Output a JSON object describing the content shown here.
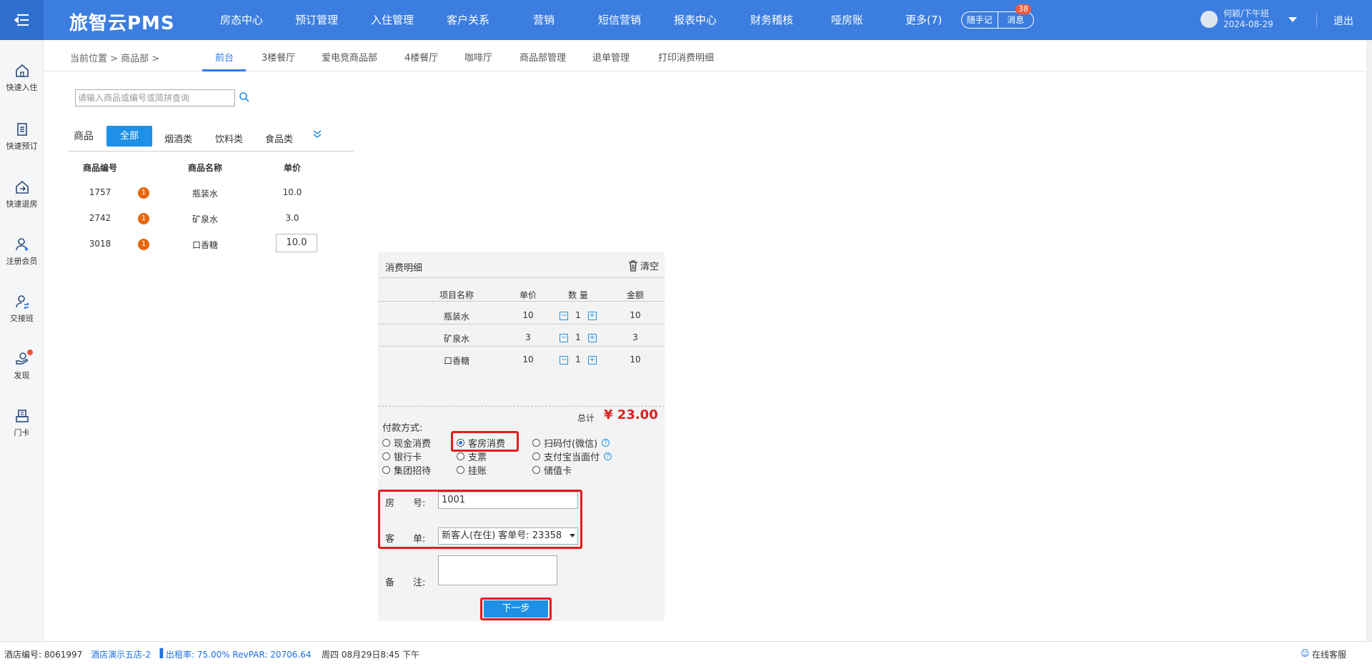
{
  "app": {
    "brand": "旅智云PMS"
  },
  "nav": [
    "房态中心",
    "预订管理",
    "入住管理",
    "客户关系",
    "营销",
    "短信营销",
    "报表中心",
    "财务稽核",
    "哑房账",
    "更多(7)"
  ],
  "header": {
    "notes": "随手记",
    "messages": "消息",
    "message_count": "38",
    "user_name": "何颖/下午班",
    "user_date": "2024-08-29",
    "logout": "退出"
  },
  "sidebar": [
    "快速入住",
    "快速预订",
    "快速退房",
    "注册会员",
    "交接班",
    "发现",
    "门卡"
  ],
  "breadcrumb": {
    "location": "当前位置 > 商品部 >"
  },
  "tabs": [
    "前台",
    "3楼餐厅",
    "爱电竞商品部",
    "4楼餐厅",
    "咖啡厅",
    "商品部管理",
    "退单管理",
    "打印消费明细"
  ],
  "search": {
    "placeholder": "请输入商品或编号或简拼查询"
  },
  "categories": {
    "label": "商品",
    "items": [
      "全部",
      "烟酒类",
      "饮料类",
      "食品类"
    ]
  },
  "goods": {
    "headers": [
      "商品编号",
      "商品名称",
      "单价"
    ],
    "rows": [
      {
        "code": "1757",
        "badge": "1",
        "name": "瓶装水",
        "price": "10.0"
      },
      {
        "code": "2742",
        "badge": "1",
        "name": "矿泉水",
        "price": "3.0"
      },
      {
        "code": "3018",
        "badge": "1",
        "name": "口香糖",
        "price": "10.0"
      }
    ]
  },
  "detail": {
    "title": "消费明细",
    "clear": "清空",
    "headers": [
      "项目名称",
      "单价",
      "数 量",
      "金额"
    ],
    "rows": [
      {
        "name": "瓶装水",
        "price": "10",
        "qty": "1",
        "amount": "10"
      },
      {
        "name": "矿泉水",
        "price": "3",
        "qty": "1",
        "amount": "3"
      },
      {
        "name": "口香糖",
        "price": "10",
        "qty": "1",
        "amount": "10"
      }
    ],
    "total_label": "总计",
    "total": "¥ 23.00",
    "pay_label": "付款方式:",
    "pay_methods": [
      "现金消费",
      "客房消费",
      "扫码付(微信)",
      "银行卡",
      "支票",
      "支付宝当面付",
      "集团招待",
      "挂账",
      "储值卡"
    ],
    "pay_selected": "客房消费",
    "room_label": "房　　号:",
    "room_value": "1001",
    "order_label": "客　　单:",
    "order_value": "新客人(在住) 客单号: 23358",
    "remark_label": "备　　注:",
    "next": "下一步"
  },
  "footer": {
    "hotel_no": "酒店编号: 8061997",
    "hotel_name": "酒店演示五店-2",
    "occupancy": "出租率: 75.00% RevPAR: 20706.64",
    "datetime": "周四 08月29日8:45 下午",
    "service": "在线客服"
  }
}
